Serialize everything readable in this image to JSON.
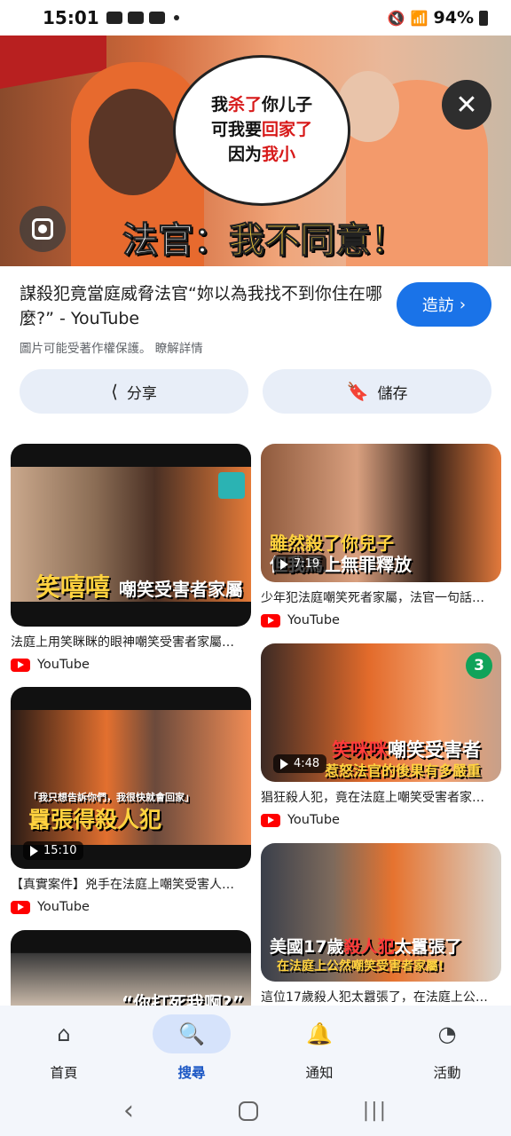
{
  "status": {
    "time": "15:01",
    "battery": "94%"
  },
  "hero": {
    "bubble_lines": [
      {
        "pre": "我",
        "red": "杀了",
        "post": "你儿子"
      },
      {
        "pre": "可我要",
        "red": "回家了",
        "post": ""
      },
      {
        "pre": "因为",
        "red": "我小",
        "post": ""
      }
    ],
    "banner_prefix": "法官：",
    "banner_text": "我不同意！"
  },
  "result": {
    "title": "謀殺犯竟當庭威脅法官“妳以為我找不到你住在哪麼?” - YouTube",
    "copyright_note": "圖片可能受著作權保護。 瞭解詳情",
    "visit_label": "造訪"
  },
  "actions": {
    "share_label": "分享",
    "save_label": "儲存"
  },
  "grid": {
    "left": [
      {
        "overlay_yellow": "笑嘻嘻",
        "overlay_white": "嘲笑受害者家屬",
        "caption": "法庭上用笑眯眯的眼神嘲笑受害者家屬…",
        "source": "YouTube"
      },
      {
        "overlay_top": "「我只想告訴你們，我很快就會回家」",
        "overlay_main": "囂張得殺人犯",
        "duration": "15:10",
        "caption": "【真實案件】兇手在法庭上嘲笑受害人…",
        "source": "YouTube"
      },
      {
        "overlay": "“你打死我啊?”"
      }
    ],
    "right": [
      {
        "overlay_line1": "雖然殺了你兒子",
        "overlay_line2": "但我馬上無罪釋放",
        "duration": "7:19",
        "caption": "少年犯法庭嘲笑死者家屬，法官一句話…",
        "source": "YouTube"
      },
      {
        "overlay_red": "笑咪咪",
        "overlay_white": "嘲笑受害者",
        "overlay_yellow": "惹怒法官的後果有多嚴重",
        "badge": "3",
        "duration": "4:48",
        "caption": "猖狂殺人犯，竟在法庭上嘲笑受害者家…",
        "source": "YouTube"
      },
      {
        "overlay_line1a": "美國17歲",
        "overlay_line1b": "殺人犯",
        "overlay_line1c": "太囂張了",
        "overlay_line2": "在法庭上公然嘲笑受害者家屬!",
        "caption": "這位17歲殺人犯太囂張了，在法庭上公…"
      }
    ]
  },
  "bottom_nav": [
    {
      "label": "首頁",
      "icon": "home-icon"
    },
    {
      "label": "搜尋",
      "icon": "search-icon"
    },
    {
      "label": "通知",
      "icon": "bell-icon"
    },
    {
      "label": "活動",
      "icon": "activity-icon"
    }
  ]
}
